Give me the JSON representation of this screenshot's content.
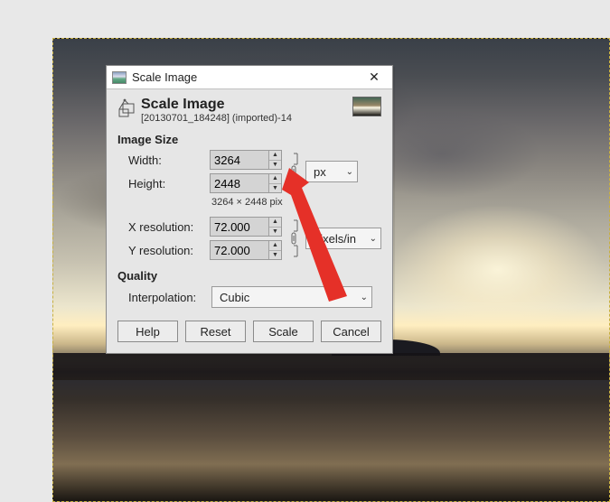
{
  "dialog": {
    "titlebar_text": "Scale Image",
    "header_title": "Scale Image",
    "header_sub": "[20130701_184248] (imported)-14",
    "image_size_label": "Image Size",
    "width_label": "Width:",
    "height_label": "Height:",
    "width_value": "3264",
    "height_value": "2448",
    "dimensions_text": "3264 × 2448 pix",
    "size_unit": "px",
    "xres_label": "X resolution:",
    "yres_label": "Y resolution:",
    "xres_value": "72.000",
    "yres_value": "72.000",
    "res_unit": "pixels/in",
    "quality_label": "Quality",
    "interp_label": "Interpolation:",
    "interp_value": "Cubic",
    "buttons": {
      "help": "Help",
      "reset": "Reset",
      "scale": "Scale",
      "cancel": "Cancel"
    }
  },
  "annotation": {
    "arrow_color": "#e53028"
  }
}
